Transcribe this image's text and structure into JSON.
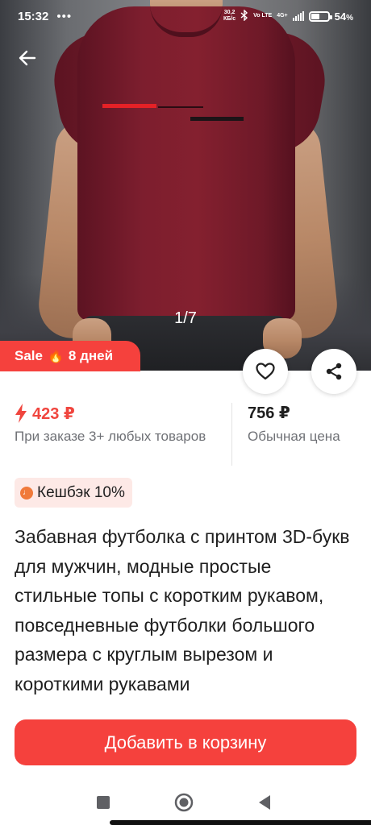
{
  "status_bar": {
    "time": "15:32",
    "more_indicator": "•••",
    "net_speed_value": "30,2",
    "net_speed_unit": "КБ/с",
    "bluetooth_icon": "bluetooth-icon",
    "volte_label": "Vo LTE",
    "network_label": "4G+",
    "battery_percent": "54",
    "battery_percent_sign": "%",
    "battery_level": 0.54
  },
  "gallery": {
    "counter": "1/7",
    "back_icon": "arrow-left-icon"
  },
  "sale_badge": {
    "label": "Sale",
    "emoji": "🔥",
    "duration": "8 дней"
  },
  "actions": {
    "favorite_icon": "heart-outline-icon",
    "share_icon": "share-icon"
  },
  "pricing": {
    "sale_price": "423 ₽",
    "sale_icon": "lightning-icon",
    "sale_condition": "При заказе 3+ любых товаров",
    "regular_price": "756 ₽",
    "regular_label": "Обычная цена"
  },
  "cashback": {
    "label": "Кешбэк 10%"
  },
  "product": {
    "title": "Забавная футболка с принтом 3D-букв для мужчин, модные простые стильные топы с коротким рукавом, повседневные футболки большого размера с круглым вырезом и короткими рукавами"
  },
  "cta": {
    "add_to_cart": "Добавить в корзину"
  },
  "colors": {
    "accent": "#f5413d",
    "sale_price": "#f0453e",
    "secondary_text": "#6f7176",
    "cashback_bg": "#fde9e6"
  },
  "nav_bar": {
    "recent_icon": "square-icon",
    "home_icon": "circle-home-icon",
    "back_icon": "triangle-back-icon"
  }
}
